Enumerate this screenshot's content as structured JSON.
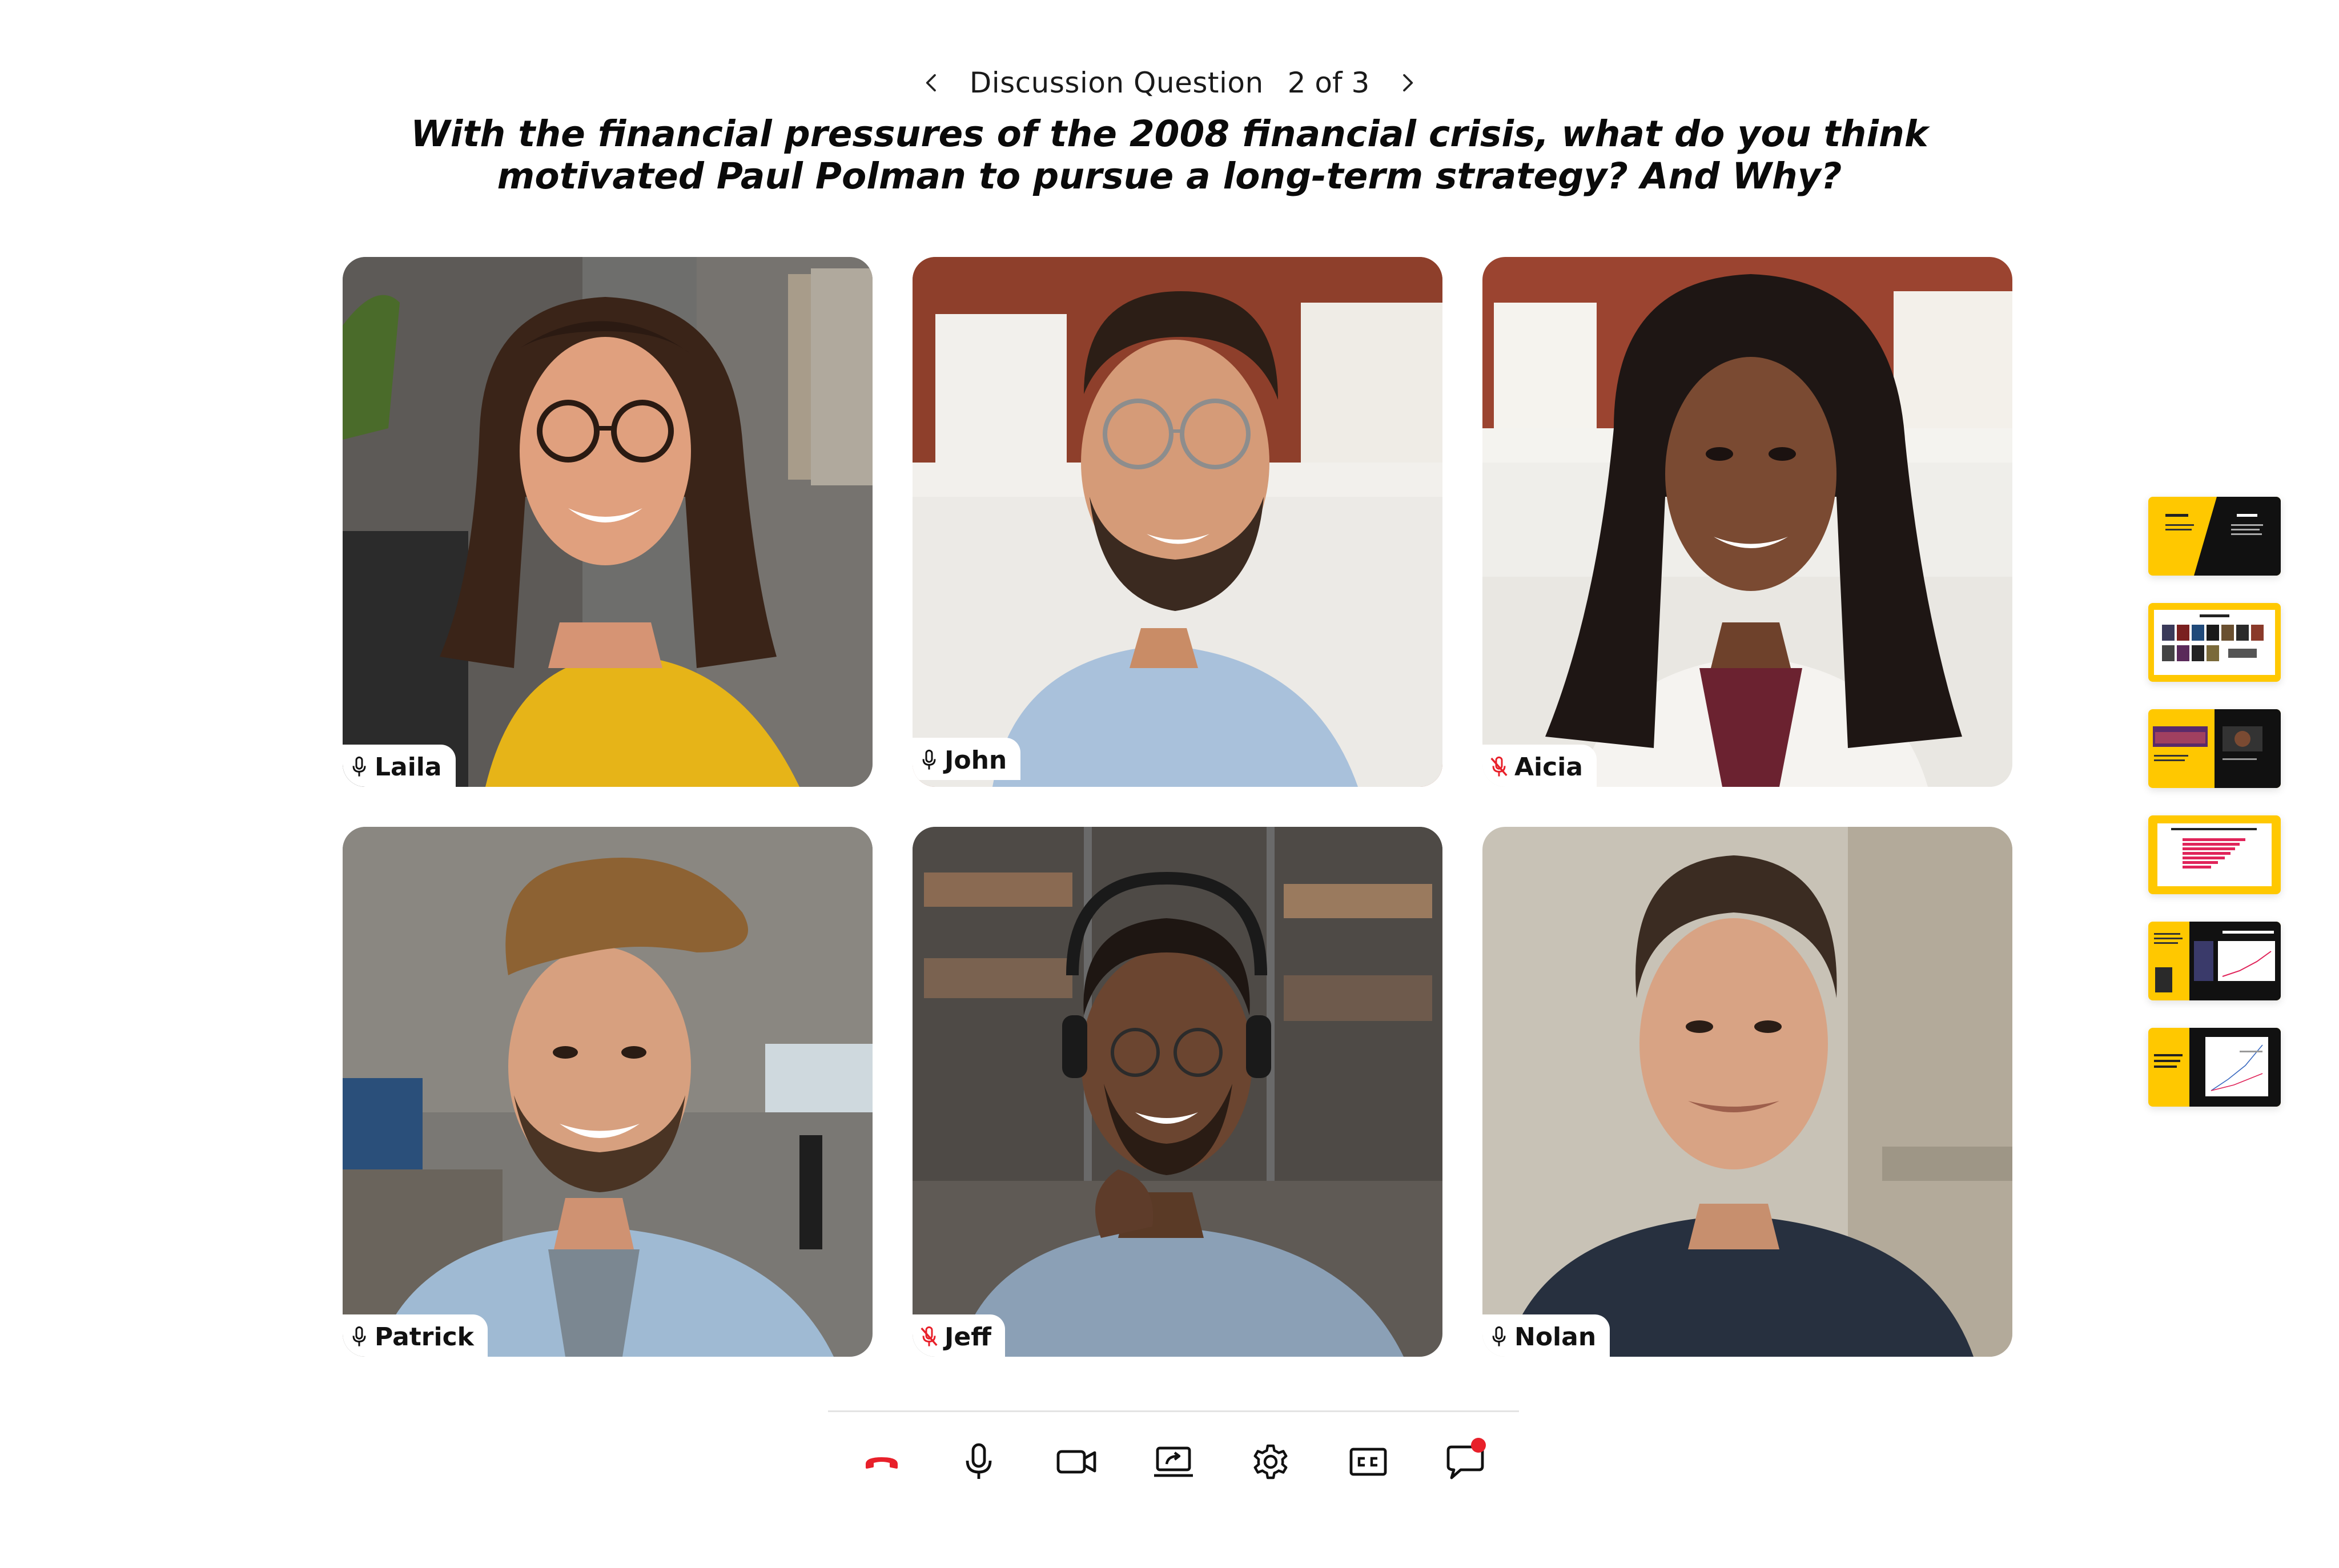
{
  "question_nav": {
    "label": "Discussion Question",
    "counter": "2 of 3",
    "prev_icon": "chevron-left-icon",
    "next_icon": "chevron-right-icon"
  },
  "question": {
    "line1": "With the financial pressures of the 2008 financial crisis, what do you think",
    "line2": "motivated Paul Polman to pursue a long-term strategy? And Why?"
  },
  "participants": [
    {
      "name": "Laila",
      "mic": "on"
    },
    {
      "name": "John",
      "mic": "on"
    },
    {
      "name": "Aicia",
      "mic": "muted"
    },
    {
      "name": "Patrick",
      "mic": "on"
    },
    {
      "name": "Jeff",
      "mic": "muted"
    },
    {
      "name": "Nolan",
      "mic": "on"
    }
  ],
  "toolbar": {
    "buttons": [
      "end-call-icon",
      "microphone-icon",
      "camera-icon",
      "share-screen-icon",
      "gear-icon",
      "captions-icon",
      "chat-icon"
    ],
    "chat_badge": true
  },
  "colors": {
    "accent": "#FFC800",
    "muted_red": "#E8202A",
    "end_call": "#E8202A",
    "text": "#111111"
  },
  "slides": {
    "count": 6
  }
}
